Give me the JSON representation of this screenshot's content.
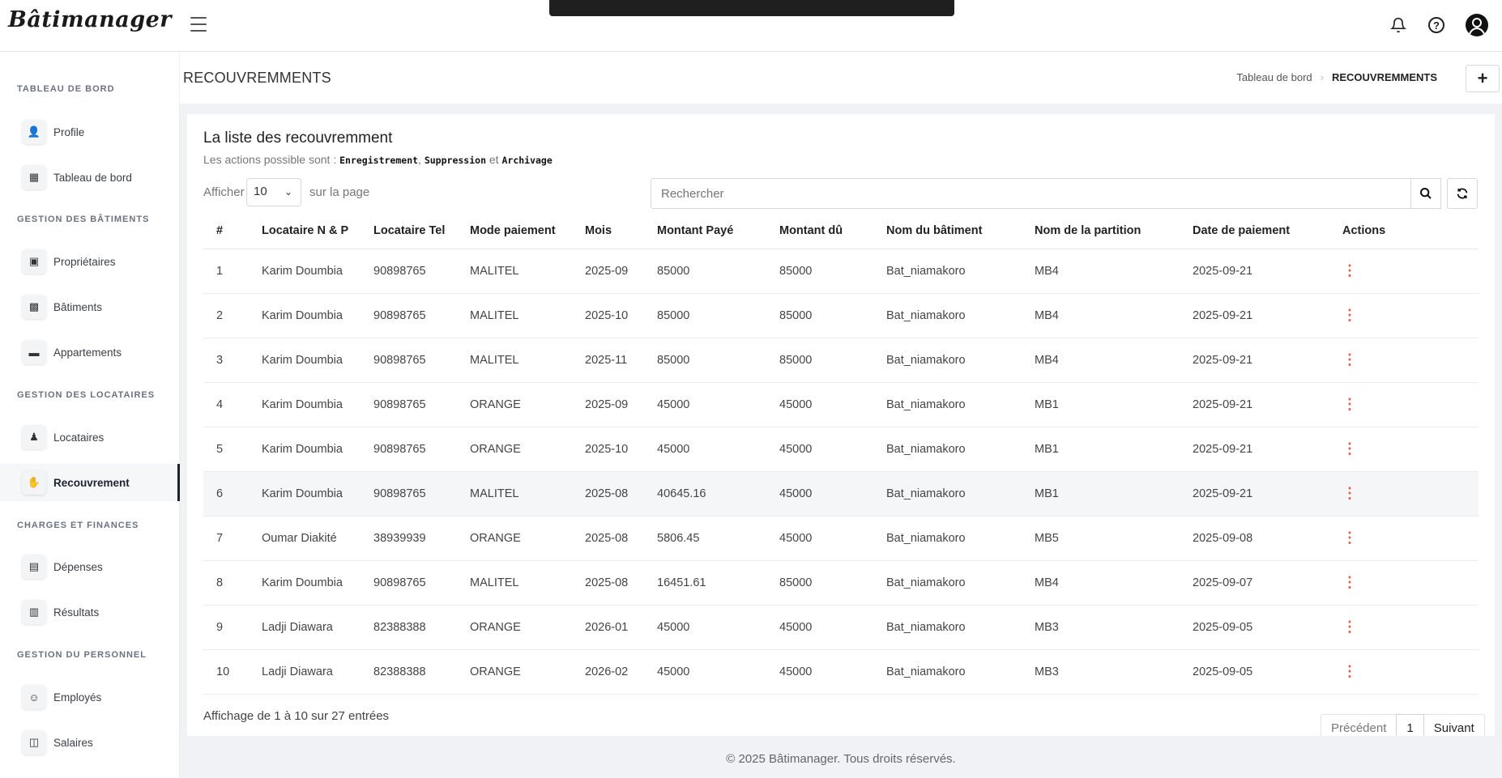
{
  "app": {
    "logo": "Bâtimanager"
  },
  "sidebar": {
    "sections": [
      {
        "heading": "TABLEAU DE BORD"
      },
      {
        "heading": "GESTION DES BÂTIMENTS"
      },
      {
        "heading": "GESTION DES LOCATAIRES"
      },
      {
        "heading": "CHARGES ET FINANCES"
      },
      {
        "heading": "GESTION DU PERSONNEL"
      }
    ],
    "items": [
      {
        "label": "Profile",
        "icon": "person-icon"
      },
      {
        "label": "Tableau de bord",
        "icon": "dashboard-icon"
      },
      {
        "label": "Propriétaires",
        "icon": "owners-icon"
      },
      {
        "label": "Bâtiments",
        "icon": "building-icon"
      },
      {
        "label": "Appartements",
        "icon": "bed-icon"
      },
      {
        "label": "Locataires",
        "icon": "tenant-icon"
      },
      {
        "label": "Recouvrement",
        "icon": "payment-hand-icon",
        "active": true
      },
      {
        "label": "Dépenses",
        "icon": "receipt-icon"
      },
      {
        "label": "Résultats",
        "icon": "chart-icon"
      },
      {
        "label": "Employés",
        "icon": "users-icon"
      },
      {
        "label": "Salaires",
        "icon": "money-icon"
      }
    ]
  },
  "header": {
    "title": "RECOUVREMMENTS",
    "breadcrumb": [
      "Tableau de bord",
      "RECOUVREMMENTS"
    ],
    "add_label": "+"
  },
  "card": {
    "title": "La liste des recouvremment",
    "subtitle_prefix": "Les actions possible sont : ",
    "actions": [
      "Enregistrement",
      "Suppression",
      "Archivage"
    ],
    "subtitle_sep": ", ",
    "subtitle_and": " et ",
    "show_label": "Afficher",
    "page_size": "10",
    "show_suffix": "sur la page",
    "search_placeholder": "Rechercher"
  },
  "table": {
    "columns": [
      "#",
      "Locataire N & P",
      "Locataire Tel",
      "Mode paiement",
      "Mois",
      "Montant Payé",
      "Montant dû",
      "Nom du bâtiment",
      "Nom de la partition",
      "Date de paiement",
      "Actions"
    ],
    "rows": [
      [
        "1",
        "Karim Doumbia",
        "90898765",
        "MALITEL",
        "2025-09",
        "85000",
        "85000",
        "Bat_niamakoro",
        "MB4",
        "2025-09-21"
      ],
      [
        "2",
        "Karim Doumbia",
        "90898765",
        "MALITEL",
        "2025-10",
        "85000",
        "85000",
        "Bat_niamakoro",
        "MB4",
        "2025-09-21"
      ],
      [
        "3",
        "Karim Doumbia",
        "90898765",
        "MALITEL",
        "2025-11",
        "85000",
        "85000",
        "Bat_niamakoro",
        "MB4",
        "2025-09-21"
      ],
      [
        "4",
        "Karim Doumbia",
        "90898765",
        "ORANGE",
        "2025-09",
        "45000",
        "45000",
        "Bat_niamakoro",
        "MB1",
        "2025-09-21"
      ],
      [
        "5",
        "Karim Doumbia",
        "90898765",
        "ORANGE",
        "2025-10",
        "45000",
        "45000",
        "Bat_niamakoro",
        "MB1",
        "2025-09-21"
      ],
      [
        "6",
        "Karim Doumbia",
        "90898765",
        "MALITEL",
        "2025-08",
        "40645.16",
        "45000",
        "Bat_niamakoro",
        "MB1",
        "2025-09-21"
      ],
      [
        "7",
        "Oumar Diakité",
        "38939939",
        "ORANGE",
        "2025-08",
        "5806.45",
        "45000",
        "Bat_niamakoro",
        "MB5",
        "2025-09-08"
      ],
      [
        "8",
        "Karim Doumbia",
        "90898765",
        "MALITEL",
        "2025-08",
        "16451.61",
        "85000",
        "Bat_niamakoro",
        "MB4",
        "2025-09-07"
      ],
      [
        "9",
        "Ladji Diawara",
        "82388388",
        "ORANGE",
        "2026-01",
        "45000",
        "45000",
        "Bat_niamakoro",
        "MB3",
        "2025-09-05"
      ],
      [
        "10",
        "Ladji Diawara",
        "82388388",
        "ORANGE",
        "2026-02",
        "45000",
        "45000",
        "Bat_niamakoro",
        "MB3",
        "2025-09-05"
      ]
    ],
    "highlighted_row": 5
  },
  "pagination": {
    "info": "Affichage de 1 à 10 sur 27 entrées",
    "prev": "Précédent",
    "current": "1",
    "next": "Suivant"
  },
  "footer": {
    "text": "© 2025 Bâtimanager. Tous droits réservés."
  },
  "colors": {
    "accent_kebab": "#e05a4a",
    "active_border": "#1d2230",
    "main_bg": "#f0f2f5"
  }
}
